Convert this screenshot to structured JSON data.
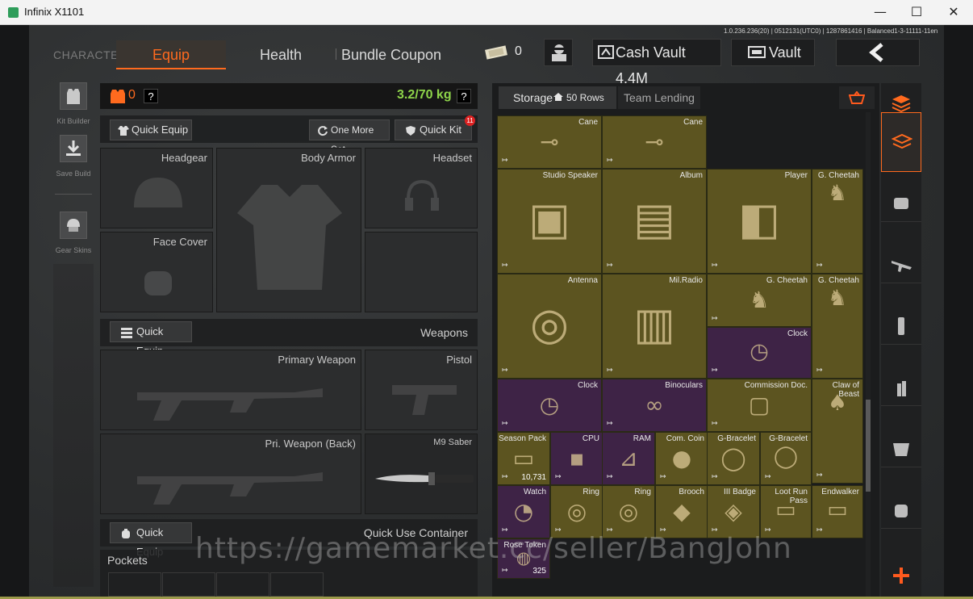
{
  "window": {
    "title": "Infinix X1101",
    "minimize": "—",
    "maximize": "☐",
    "close": "✕"
  },
  "version": "1.0.236.236(20) | 0512131(UTC0) | 1287861416 | Balanced1-3-11111-11en",
  "tabs": {
    "character": "CHARACTER",
    "equip": "Equip",
    "health": "Health",
    "bundle": "Bundle Coupon"
  },
  "topbar": {
    "tickets": "0",
    "cash_vault": "Cash Vault 4.4M",
    "vault": "Vault"
  },
  "sidebar": {
    "kit_builder": "Kit Builder",
    "save_build": "Save Build",
    "gear_skins": "Gear Skins"
  },
  "loadout": {
    "armor_count": "0",
    "weight": "3.2/70 kg",
    "help": "?",
    "quick_equip": "Quick Equip",
    "one_more_set": "One More Set",
    "quick_kit": "Quick Kit",
    "quick_kit_badge": "11",
    "slots": {
      "headgear": "Headgear",
      "body_armor": "Body Armor",
      "headset": "Headset",
      "face_cover": "Face Cover"
    },
    "weapons_quick_equip": "Quick Equip",
    "weapons_title": "Weapons",
    "primary": "Primary Weapon",
    "pistol": "Pistol",
    "back": "Pri. Weapon (Back)",
    "melee": "M9 Saber",
    "container_quick_equip": "Quick Equip",
    "container_title": "Quick Use Container",
    "pockets": "Pockets"
  },
  "storage": {
    "tab": "Storage",
    "rows": "50 Rows",
    "lending": "Team Lending",
    "items": [
      {
        "name": "Cane",
        "color": "gold"
      },
      {
        "name": "Cane",
        "color": "gold"
      },
      {
        "name": "Studio Speaker",
        "color": "gold"
      },
      {
        "name": "Album",
        "color": "gold"
      },
      {
        "name": "Player",
        "color": "gold"
      },
      {
        "name": "G. Cheetah",
        "color": "gold"
      },
      {
        "name": "Antenna",
        "color": "gold"
      },
      {
        "name": "Mil.Radio",
        "color": "gold"
      },
      {
        "name": "G. Cheetah",
        "color": "gold"
      },
      {
        "name": "G. Cheetah",
        "color": "gold"
      },
      {
        "name": "Clock",
        "color": "purple"
      },
      {
        "name": "Clock",
        "color": "purple"
      },
      {
        "name": "Binoculars",
        "color": "purple"
      },
      {
        "name": "Commission Doc.",
        "color": "gold"
      },
      {
        "name": "Claw of Beast",
        "color": "gold"
      },
      {
        "name": "Season Pack",
        "color": "gold",
        "count": "10,731"
      },
      {
        "name": "CPU",
        "color": "purple"
      },
      {
        "name": "RAM",
        "color": "purple"
      },
      {
        "name": "Com. Coin",
        "color": "gold"
      },
      {
        "name": "G-Bracelet",
        "color": "gold"
      },
      {
        "name": "G-Bracelet",
        "color": "gold"
      },
      {
        "name": "Watch",
        "color": "purple"
      },
      {
        "name": "Ring",
        "color": "gold"
      },
      {
        "name": "Ring",
        "color": "gold"
      },
      {
        "name": "Brooch",
        "color": "gold"
      },
      {
        "name": "III Badge",
        "color": "gold"
      },
      {
        "name": "Loot Run Pass",
        "color": "gold"
      },
      {
        "name": "Endwalker",
        "color": "gold"
      },
      {
        "name": "Rose Token",
        "color": "purple",
        "count": "325"
      }
    ]
  },
  "watermark": "https://gamemarket.cc/seller/BangJohn"
}
